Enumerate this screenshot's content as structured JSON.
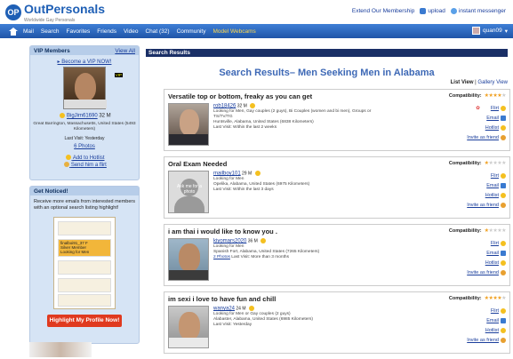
{
  "brand": {
    "name": "OutPersonals",
    "tagline": "Worldwide Gay Personals",
    "logo_letters": "OP"
  },
  "toplinks": [
    "Extend Our Membership",
    "upload",
    "instant messenger"
  ],
  "nav": {
    "items": [
      "Mail",
      "Search",
      "Favorites",
      "Friends",
      "Video",
      "Chat (32)",
      "Community",
      "Model Webcams"
    ],
    "user": "quan09"
  },
  "vip": {
    "header": "VIP Members",
    "view_all": "View All",
    "become_link": "Become a VIP NOW!",
    "badge": "VIP",
    "username": "BigJim61690",
    "age_sex": "32 M",
    "location": "Great Barrington, Massachusetts, United States (5493 Kilometers)",
    "last_visit": "Last Visit: Yesterday",
    "photos": "6 Photos",
    "add_hotlist": "Add to Hotlist",
    "send_flirt": "Send him a flirt"
  },
  "noticed": {
    "header": "Get Noticed!",
    "text": "Receive more emails from interested members with an optional search listing highlight!",
    "sample_name": "finalboi91_37 F",
    "sample_tier": "Silver Member",
    "sample_looking": "Looking for Men",
    "button": "Highlight My Profile Now!"
  },
  "main": {
    "bar": "Search Results",
    "title": "Search Results– Men Seeking Men in Alabama",
    "list_view": "List View",
    "gallery_view": "Gallery View"
  },
  "cards": [
    {
      "title": "Versatile top or bottom, freaky as you can get",
      "compat_label": "Compatibility:",
      "stars": 4,
      "username": "rob18426",
      "age": "32 M",
      "line1": "Looking for Men, Gay couples (2 guys), Bi Couples (women and bi men), Groups or TS/TV/TG",
      "line2": "Huntsville, Alabama, United States (6838 Kilometers)",
      "line3": "Last Visit: Within the last 2 weeks",
      "actions": [
        "Flirt",
        "Email",
        "Hotlist",
        "Invite as friend"
      ]
    },
    {
      "title": "Oral Exam Needed",
      "compat_label": "Compatibility:",
      "stars": 1,
      "username": "mailboy101",
      "age": "29 M",
      "line1": "Looking for Men",
      "line2": "Opelika, Alabama, United States (6975 Kilometers)",
      "line3": "Last Visit: Within the last 3 days",
      "photo_text": "Ask me for a photo",
      "actions": [
        "Flirt",
        "Email",
        "Hotlist",
        "Invite as friend"
      ]
    },
    {
      "title": "i am thai i would like to know you .",
      "compat_label": "Compatibility:",
      "stars": 1,
      "username": "kiyomars2020",
      "age": "36 M",
      "line1": "Looking for Men",
      "line2": "Spanish Fort, Alabama, United States (7265 Kilometers)",
      "photos": "2 Photos",
      "line3": "Last Visit: More than 3 months",
      "actions": [
        "Flirt",
        "Email",
        "Hotlist",
        "Invite as friend"
      ]
    },
    {
      "title": "im sexi i love to have fun and chill",
      "compat_label": "Compatibility:",
      "stars": 4,
      "username": "wanya24",
      "age": "24 M",
      "line1": "Looking for Men or Gay couples (2 guys)",
      "line2": "Alabaster, Alabama, United States (6985 Kilometers)",
      "line3": "Last Visit: Yesterday",
      "actions": [
        "Flirt",
        "Email",
        "Hotlist",
        "Invite as friend"
      ]
    }
  ],
  "colors": {
    "nav": "#2f6cc4",
    "accent": "#1a3e9c",
    "highlight_button": "#e03a1f",
    "stars": "#f0a020"
  }
}
